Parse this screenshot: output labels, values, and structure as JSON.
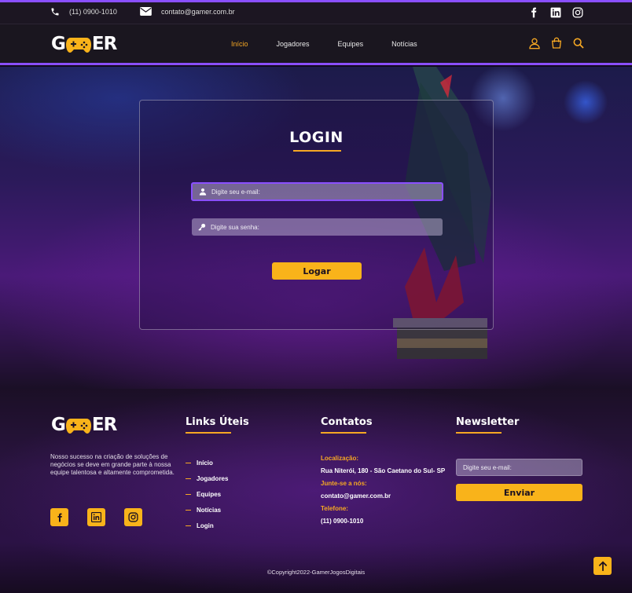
{
  "topbar": {
    "phone": "(11) 0900-1010",
    "email": "contato@gamer.com.br",
    "social_icons": [
      "facebook-icon",
      "linkedin-icon",
      "instagram-icon"
    ]
  },
  "nav": {
    "logo": {
      "left": "G",
      "middle": "AM",
      "right": "ER"
    },
    "menu": [
      "Início",
      "Jogadores",
      "Equipes",
      "Notícias"
    ],
    "active_index": 0,
    "icons": [
      "user-icon",
      "cart-icon",
      "search-icon"
    ]
  },
  "login": {
    "title": "LOGIN",
    "email_placeholder": "Digite seu e-mail:",
    "password_placeholder": "Digite sua senha:",
    "button": "Logar"
  },
  "footer": {
    "about": "Nosso sucesso na criação de soluções de negócios se deve em grande parte à nossa equipe talentosa e altamente comprometida.",
    "links_title": "Links Úteis",
    "links": [
      "Início",
      "Jogadores",
      "Equipes",
      "Notícias",
      "Login"
    ],
    "contacts_title": "Contatos",
    "contacts": {
      "location_label": "Localização:",
      "location": "Rua Niterói, 180 - São Caetano do Sul- SP",
      "join_label": "Junte-se a nós:",
      "join": "contato@gamer.com.br",
      "phone_label": "Telefone:",
      "phone": "(11) 0900-1010"
    },
    "newsletter_title": "Newsletter",
    "newsletter_placeholder": "Digite seu e-mail:",
    "newsletter_button": "Enviar",
    "copyright": "©Copyright2022-GamerJogosDigitais"
  },
  "colors": {
    "accent": "#f9b31a",
    "purple": "#8a4fff"
  }
}
